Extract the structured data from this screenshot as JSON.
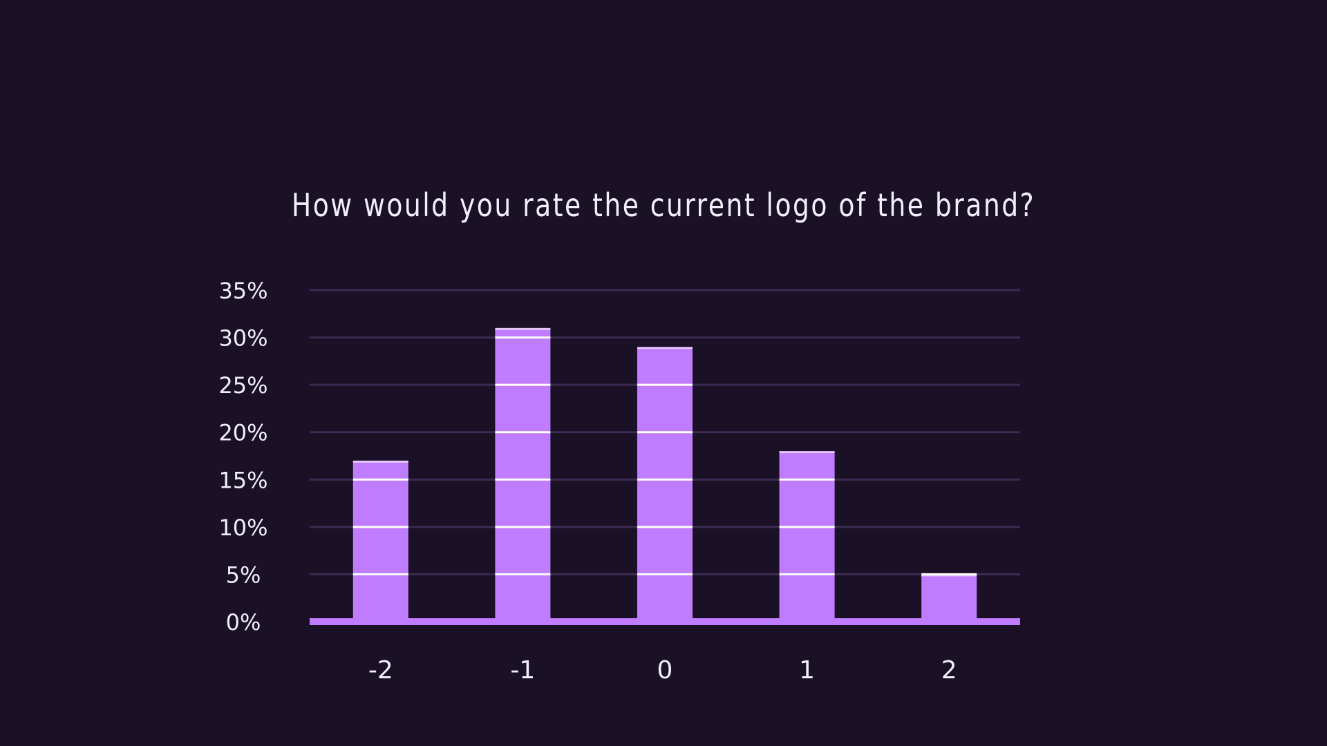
{
  "chart_data": {
    "type": "bar",
    "title": "How would you rate the current logo of the brand?",
    "xlabel": "",
    "ylabel": "",
    "categories": [
      "-2",
      "-1",
      "0",
      "1",
      "2"
    ],
    "values": [
      17,
      31,
      29,
      18,
      5
    ],
    "ylim": [
      0,
      35
    ],
    "yticks": [
      0,
      5,
      10,
      15,
      20,
      25,
      30,
      35
    ],
    "ytick_labels": [
      "0%",
      "5%",
      "10%",
      "15%",
      "20%",
      "25%",
      "30%",
      "35%"
    ],
    "grid": true,
    "legend": "none"
  },
  "colors": {
    "background": "#1b1126",
    "bar": "#c07cff",
    "gridline": "#3a2b52",
    "bar_stripe": "#ffffff",
    "text": "#f2eefa"
  }
}
